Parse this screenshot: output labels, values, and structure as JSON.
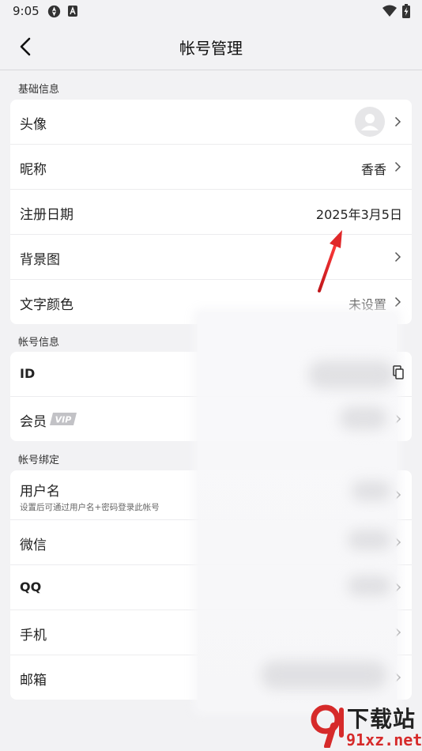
{
  "status": {
    "time": "9:05",
    "icons": [
      "navigation-app-icon",
      "a-letter-icon",
      "wifi-icon",
      "battery-charging-icon"
    ]
  },
  "header": {
    "title": "帐号管理",
    "back_icon": "chevron-left-icon"
  },
  "sections": [
    {
      "label": "基础信息",
      "rows": [
        {
          "label": "头像",
          "value": "",
          "kind": "avatar"
        },
        {
          "label": "昵称",
          "value": "香香"
        },
        {
          "label": "注册日期",
          "value": "2025年3月5日"
        },
        {
          "label": "背景图",
          "value": ""
        },
        {
          "label": "文字颜色",
          "value": "未设置"
        }
      ]
    },
    {
      "label": "帐号信息",
      "rows": [
        {
          "label": "ID",
          "value": ""
        },
        {
          "label": "会员",
          "badge": "VIP",
          "value": ""
        }
      ]
    },
    {
      "label": "帐号绑定",
      "rows": [
        {
          "label": "用户名",
          "sub": "设置后可通过用户名+密码登录此帐号",
          "value": ""
        },
        {
          "label": "微信",
          "value": ""
        },
        {
          "label": "QQ",
          "value": ""
        },
        {
          "label": "手机",
          "value": ""
        },
        {
          "label": "邮箱",
          "value": ""
        }
      ]
    }
  ],
  "watermark": {
    "top": "下载站",
    "bottom": "91xz.net"
  },
  "colors": {
    "background": "#f2f2f4",
    "card": "#ffffff",
    "annotation_arrow": "#e0282a",
    "watermark_red": "#d62a2a"
  }
}
